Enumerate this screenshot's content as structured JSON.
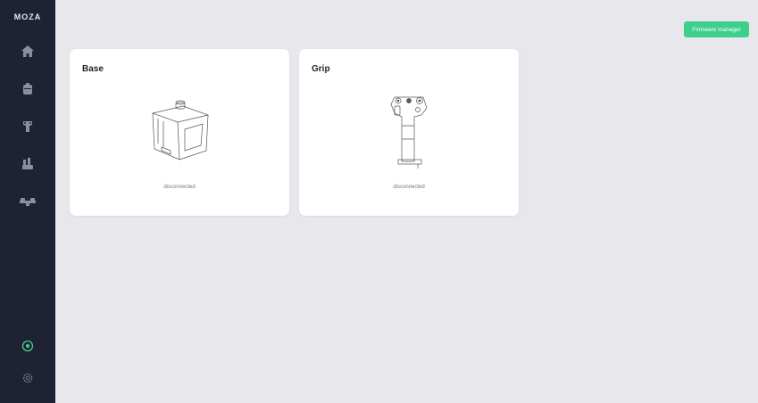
{
  "app": {
    "logo": "MOZA"
  },
  "sidebar": {
    "items": [
      {
        "name": "home",
        "icon": "home-icon"
      },
      {
        "name": "base",
        "icon": "base-icon"
      },
      {
        "name": "grip",
        "icon": "grip-icon"
      },
      {
        "name": "throttle",
        "icon": "throttle-icon"
      },
      {
        "name": "pedals",
        "icon": "pedals-icon"
      }
    ],
    "bottom": [
      {
        "name": "help",
        "icon": "help-icon"
      },
      {
        "name": "settings",
        "icon": "gear-icon"
      }
    ]
  },
  "header": {
    "firmware_button": "Firmware manager"
  },
  "devices": [
    {
      "title": "Base",
      "status": "disconnected",
      "icon": "base-device-illustration"
    },
    {
      "title": "Grip",
      "status": "disconnected",
      "icon": "grip-device-illustration"
    }
  ],
  "colors": {
    "sidebar": "#1f2233",
    "background": "#e8e8ec",
    "accent": "#3ecf8e",
    "card": "#ffffff"
  }
}
